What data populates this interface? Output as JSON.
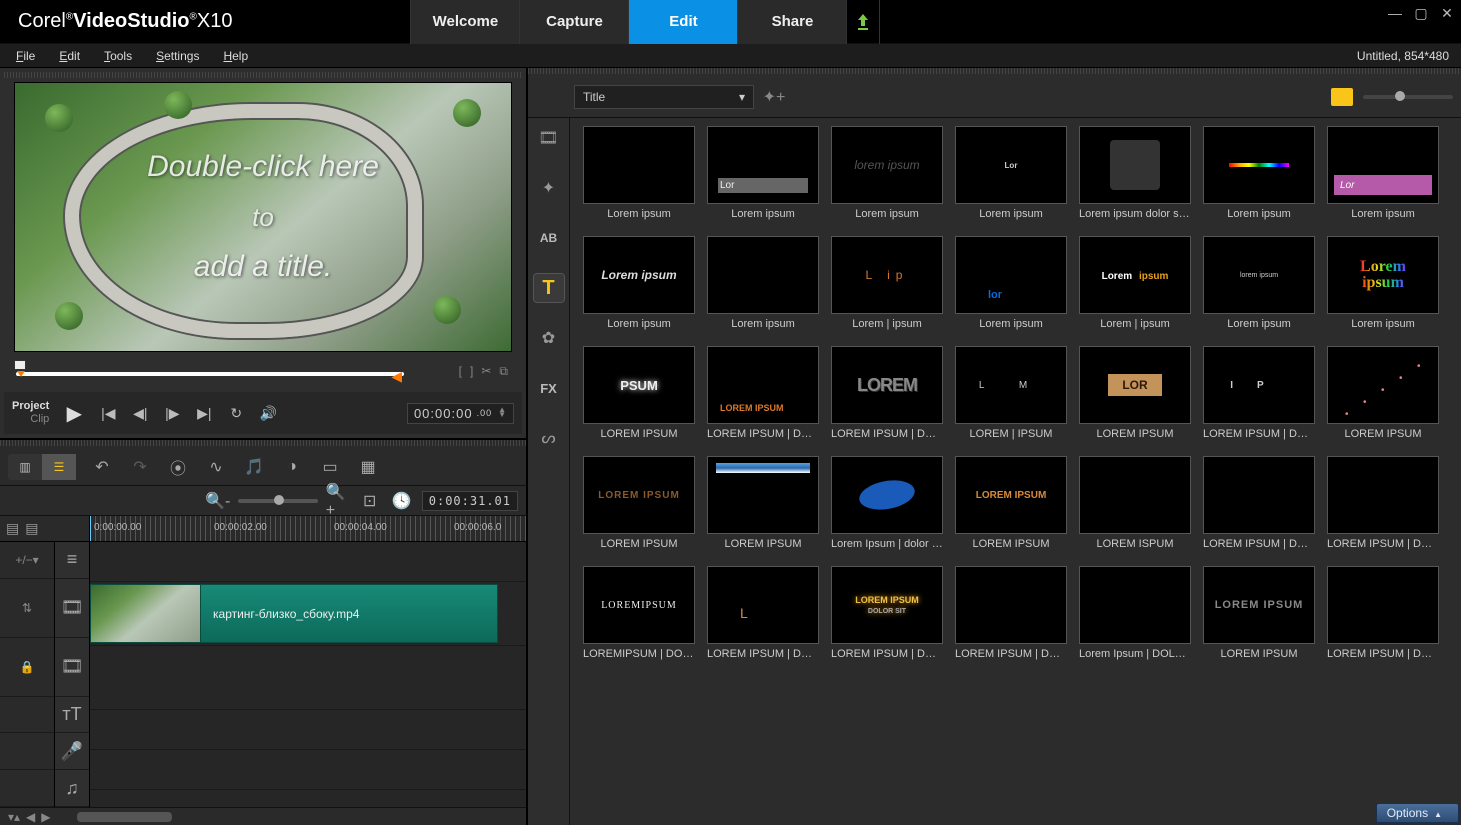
{
  "app": {
    "brand_light": "Corel",
    "brand_bold": "VideoStudio",
    "version": "X10",
    "reg": "®"
  },
  "main_tabs": {
    "welcome": "Welcome",
    "capture": "Capture",
    "edit": "Edit",
    "share": "Share"
  },
  "project_info": "Untitled, 854*480",
  "menu": {
    "file": "File",
    "edit": "Edit",
    "tools": "Tools",
    "settings": "Settings",
    "help": "Help"
  },
  "preview": {
    "overlay_line1": "Double-click here",
    "overlay_line2": "to",
    "overlay_line3": "add a title.",
    "mode_project": "Project",
    "mode_clip": "Clip",
    "timecode": "00:00:00",
    "timecode_frames": ".00"
  },
  "timeline": {
    "duration": "0:00:31.01",
    "marks": [
      "0:00:00.00",
      "00:00:02.00",
      "00:00:04.00",
      "00:00:06.0"
    ],
    "clip_name": "картинг-близко_сбоку.mp4",
    "add_menu": "+/−▾"
  },
  "library": {
    "dropdown": "Title",
    "side_labels": {
      "media": "Media",
      "instant": "Instant",
      "ab": "AB",
      "title": "T",
      "transition": "Transition",
      "fx": "FX",
      "path": "Path"
    },
    "thumbs": [
      {
        "label": "Lorem ipsum",
        "inner": ""
      },
      {
        "label": "Lorem ipsum",
        "inner": "Lor",
        "style": "bar"
      },
      {
        "label": "Lorem ipsum",
        "inner": "lorem ipsum",
        "style": "gray-italic"
      },
      {
        "label": "Lorem ipsum",
        "inner": "Lor",
        "style": "tiny"
      },
      {
        "label": "Lorem ipsum dolor sit a...",
        "inner": "",
        "style": "big-gray"
      },
      {
        "label": "Lorem ipsum",
        "inner": "",
        "style": "rainbow-line"
      },
      {
        "label": "Lorem ipsum",
        "inner": "Lor",
        "style": "purple-bar"
      },
      {
        "label": "Lorem ipsum",
        "inner": "Lorem ipsum",
        "style": "italic-white"
      },
      {
        "label": "Lorem ipsum",
        "inner": "",
        "style": "empty"
      },
      {
        "label": "Lorem | ipsum",
        "inner": "L   ip",
        "style": "orange-chars"
      },
      {
        "label": "Lorem ipsum",
        "inner": "lor",
        "style": "blue-small"
      },
      {
        "label": "Lorem | ipsum",
        "inner": "Lorem ipsum",
        "style": "white-orange"
      },
      {
        "label": "Lorem ipsum",
        "inner": "",
        "style": "tiny-white"
      },
      {
        "label": "Lorem ipsum",
        "inner": "Lorem ipsum",
        "style": "rainbow-serif"
      },
      {
        "label": "LOREM IPSUM",
        "inner": "PSUM",
        "style": "bold-white"
      },
      {
        "label": "LOREM IPSUM | DOL...",
        "inner": "LOREM IPSUM",
        "style": "orange-under"
      },
      {
        "label": "LOREM IPSUM | DOL...",
        "inner": "LOREM",
        "style": "emboss"
      },
      {
        "label": "LOREM | IPSUM",
        "inner": "L   M",
        "style": "spread"
      },
      {
        "label": "LOREM IPSUM",
        "inner": "LOR",
        "style": "tan-box"
      },
      {
        "label": "LOREM IPSUM | DOL...",
        "inner": "IP",
        "style": "cols"
      },
      {
        "label": "LOREM IPSUM",
        "inner": "",
        "style": "diag-dots"
      },
      {
        "label": "LOREM IPSUM",
        "inner": "LOREM IPSUM",
        "style": "dark-orange"
      },
      {
        "label": "LOREM IPSUM",
        "inner": "",
        "style": "blue-bar-top"
      },
      {
        "label": "Lorem Ipsum |  dolor sit ...",
        "inner": "",
        "style": "blue-oval"
      },
      {
        "label": "LOREM IPSUM",
        "inner": "LOREM IPSUM",
        "style": "orange-caps"
      },
      {
        "label": "LOREM ISPUM",
        "inner": "",
        "style": "empty"
      },
      {
        "label": "LOREM IPSUM | DOL...",
        "inner": "",
        "style": "empty"
      },
      {
        "label": "LOREM IPSUM | DOL...",
        "inner": "",
        "style": "empty"
      },
      {
        "label": "LOREMIPSUM | DOLO...",
        "inner": "LOREMIPSUM",
        "style": "serif-white"
      },
      {
        "label": "LOREM IPSUM | DOL...",
        "inner": "L",
        "style": "orange-L"
      },
      {
        "label": "LOREM IPSUM | DOL...",
        "inner": "LOREM IPSUM",
        "style": "gold-glow"
      },
      {
        "label": "LOREM IPSUM | DOL...",
        "inner": "",
        "style": "empty"
      },
      {
        "label": "Lorem Ipsum | DOLOR ...",
        "inner": "",
        "style": "empty"
      },
      {
        "label": "LOREM IPSUM",
        "inner": "LOREM IPSUM",
        "style": "gray-caps"
      },
      {
        "label": "LOREM IPSUM | DOL...",
        "inner": "",
        "style": "empty"
      }
    ]
  },
  "options_button": "Options"
}
